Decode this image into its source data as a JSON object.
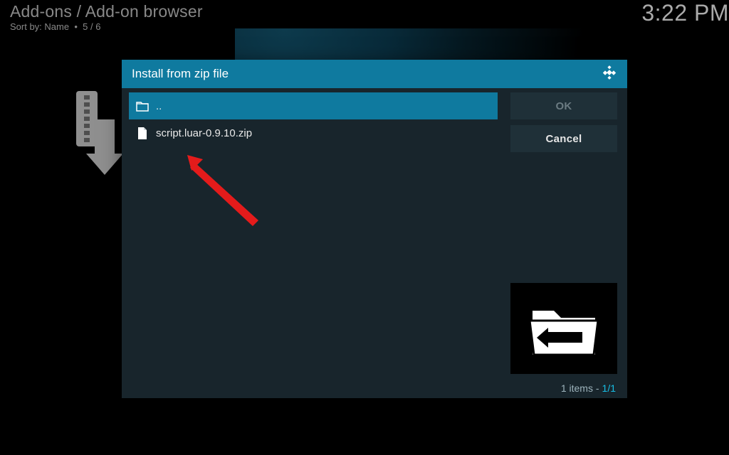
{
  "header": {
    "breadcrumb": "Add-ons / Add-on browser",
    "sort_label": "Sort by: Name",
    "sort_dot": "•",
    "sort_count": "5 / 6",
    "clock": "3:22 PM"
  },
  "dialog": {
    "title": "Install from zip file",
    "files": {
      "parent_label": "..",
      "item_label": "script.luar-0.9.10.zip"
    },
    "buttons": {
      "ok": "OK",
      "cancel": "Cancel"
    },
    "footer": {
      "count_label": "1 items -",
      "page": "1/1"
    }
  }
}
